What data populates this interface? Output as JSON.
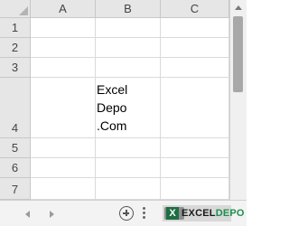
{
  "columns": [
    "A",
    "B",
    "C"
  ],
  "rows": [
    "1",
    "2",
    "3",
    "4",
    "5",
    "6",
    "7"
  ],
  "cells": {
    "B4": [
      "Excel",
      "Depo",
      ".Com"
    ]
  },
  "tabbar": {
    "watermark_part1": "EXCEL",
    "watermark_part2": "DEPO"
  },
  "colors": {
    "header_bg": "#e6e6e6",
    "gridline": "#dadada",
    "brand_green": "#1d6f42"
  }
}
